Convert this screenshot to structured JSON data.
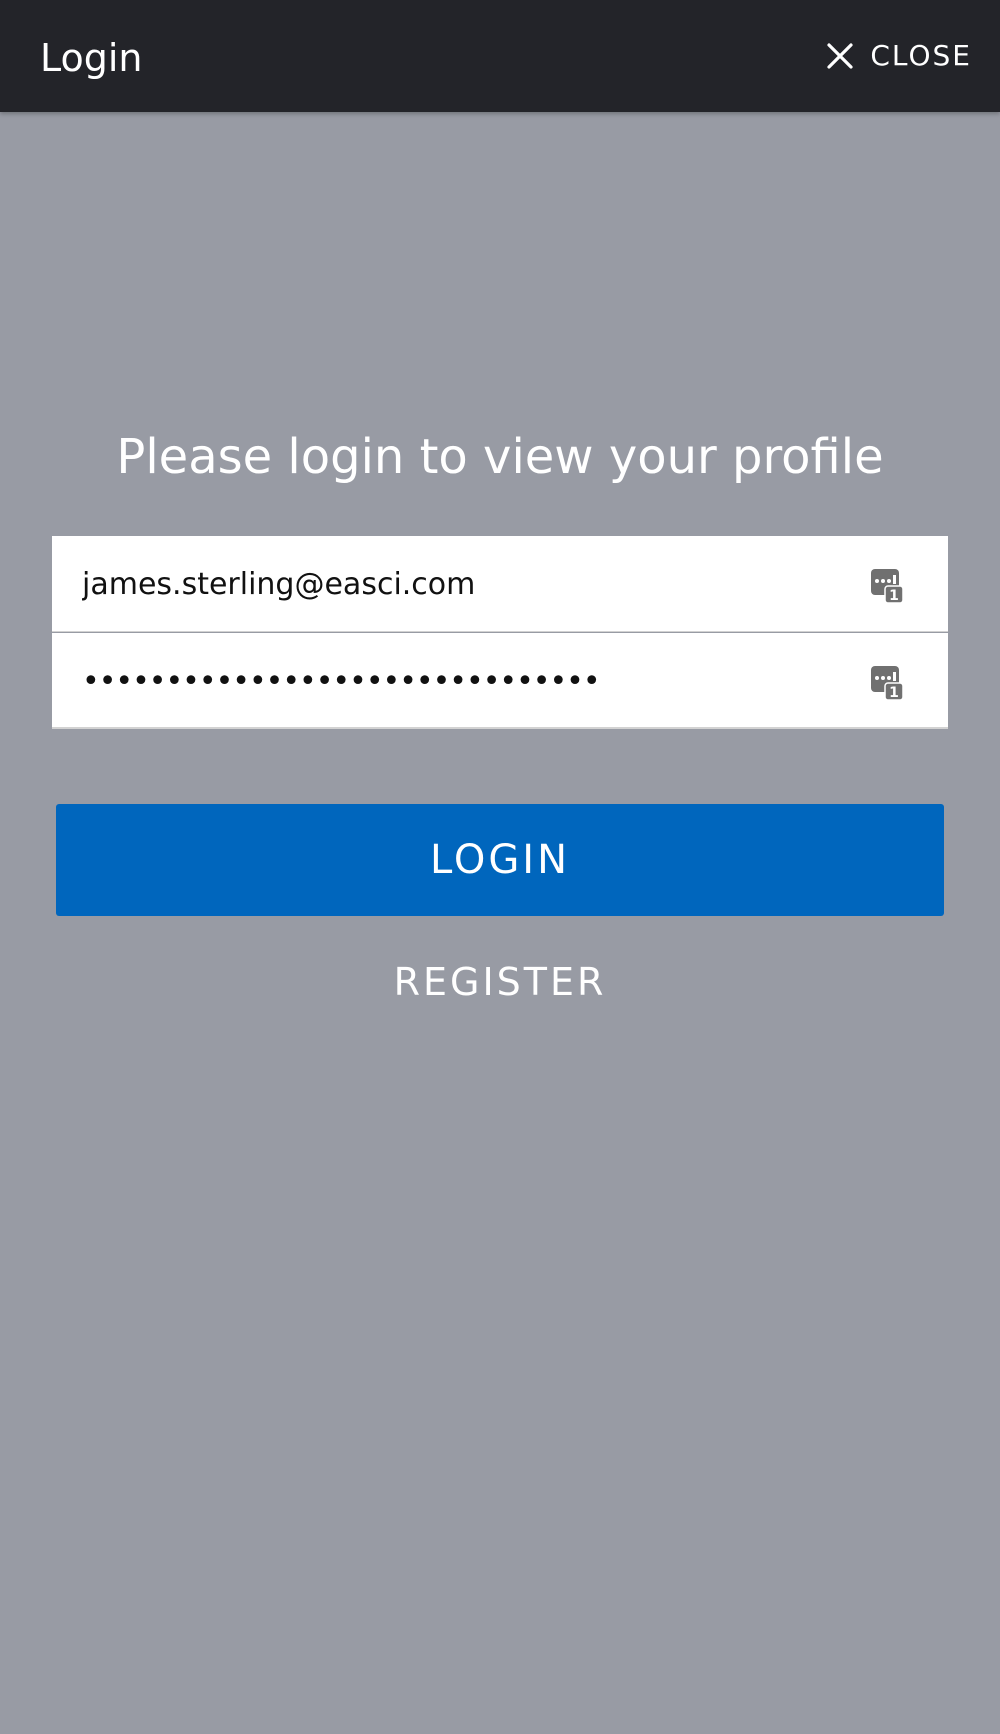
{
  "header": {
    "title": "Login",
    "close_label": "CLOSE",
    "close_icon": "close-x-icon"
  },
  "main": {
    "heading": "Please login to view your profile",
    "email": {
      "value": "james.sterling@easci.com",
      "icon": "password-manager-icon"
    },
    "password": {
      "value": "abcdefghijklmnopqrstuvwxyz12345",
      "icon": "password-manager-icon"
    },
    "login_label": "LOGIN",
    "register_label": "REGISTER"
  },
  "colors": {
    "topbar": "#232429",
    "background": "#989ba4",
    "primary_button": "#0066bd",
    "field_background": "#ffffff"
  }
}
